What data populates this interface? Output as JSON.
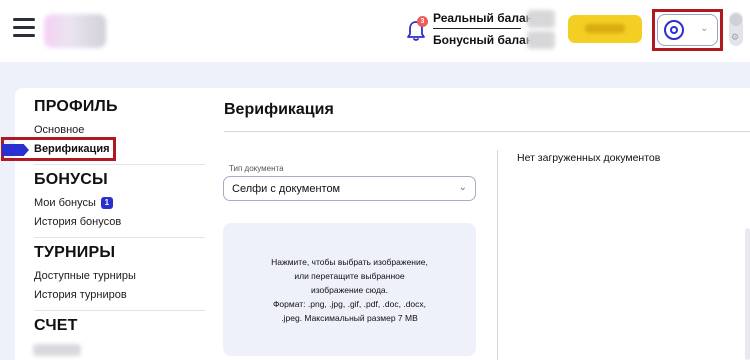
{
  "header": {
    "notification_count": "3",
    "real_balance_label": "Реальный баланс",
    "bonus_balance_label": "Бонусный баланс"
  },
  "sidebar": {
    "sections": [
      {
        "title": "ПРОФИЛЬ",
        "items": [
          {
            "label": "Основное"
          },
          {
            "label": "Верификация"
          }
        ]
      },
      {
        "title": "БОНУСЫ",
        "items": [
          {
            "label": "Мои бонусы",
            "badge": "1"
          },
          {
            "label": "История бонусов"
          }
        ]
      },
      {
        "title": "ТУРНИРЫ",
        "items": [
          {
            "label": "Доступные турниры"
          },
          {
            "label": "История турниров"
          }
        ]
      },
      {
        "title": "СЧЕТ",
        "items": []
      }
    ]
  },
  "main": {
    "title": "Верификация",
    "document_type": {
      "label": "Тип документа",
      "selected": "Селфи с документом"
    },
    "dropzone": {
      "lines": [
        "Нажмите, чтобы выбрать изображение,",
        "или перетащите выбранное",
        "изображение сюда.",
        "Формат: .png, .jpg, .gif, .pdf, .doc, .docx,",
        ".jpeg. Максимальный размер 7 MB"
      ]
    },
    "documents_empty_text": "Нет загруженных документов"
  }
}
